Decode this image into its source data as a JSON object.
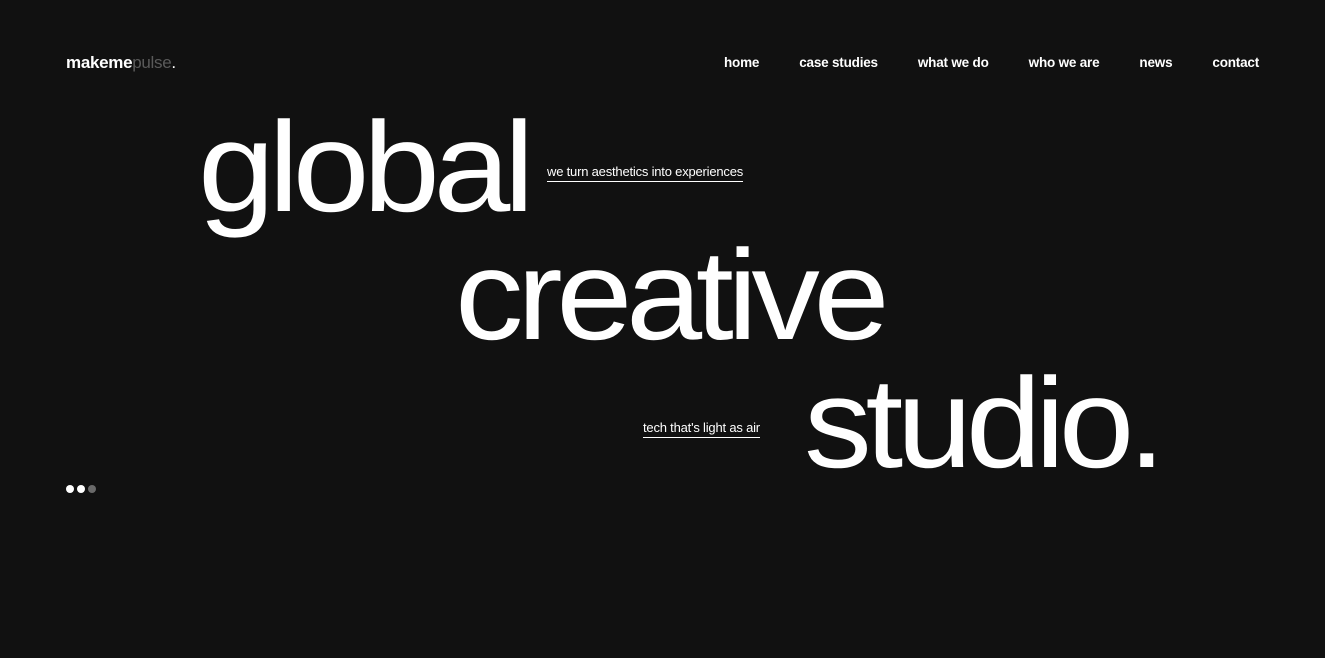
{
  "brand": {
    "logo_main": "makeme",
    "logo_dim": "pulse",
    "logo_dot": "."
  },
  "nav": {
    "items": [
      {
        "label": "home"
      },
      {
        "label": "case studies"
      },
      {
        "label": "what we do"
      },
      {
        "label": "who we are"
      },
      {
        "label": "news"
      },
      {
        "label": "contact"
      }
    ]
  },
  "hero": {
    "line1": "global",
    "line2": "creative",
    "line3": "studio.",
    "tagline1": "we turn aesthetics into experiences",
    "tagline2": "tech that's light as air"
  },
  "pager": {
    "dots": 3,
    "active": [
      0,
      1
    ]
  },
  "colors": {
    "background": "#111111",
    "text": "#ffffff",
    "muted": "#5a5a5a"
  }
}
